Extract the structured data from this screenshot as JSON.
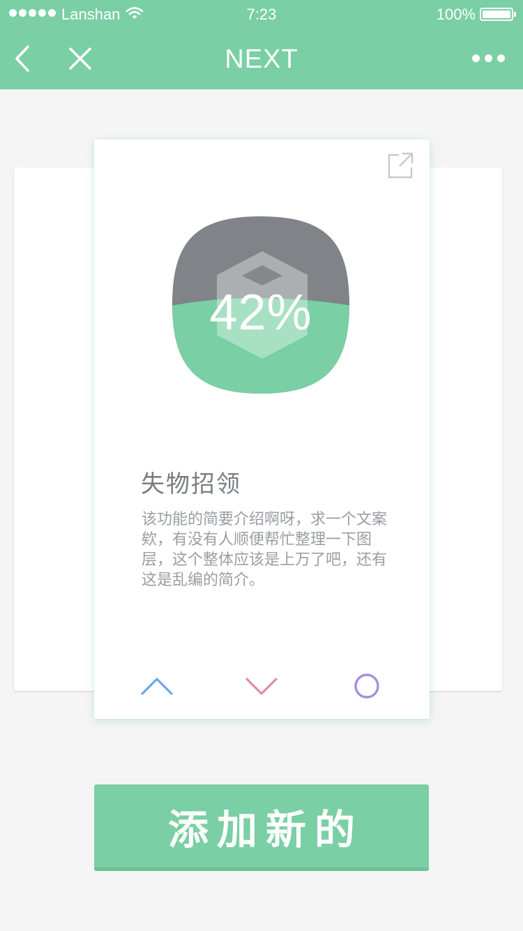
{
  "status_bar": {
    "carrier": "Lanshan",
    "time": "7:23",
    "battery": "100%"
  },
  "nav": {
    "title": "NEXT",
    "icons": [
      "back-icon",
      "close-icon",
      "more-icon"
    ]
  },
  "card": {
    "progress_label": "42%",
    "progress_value": 0.42,
    "title": "失物招领",
    "description": "该功能的简要介绍啊呀，求一个文案欸，有没有人顺便帮忙整理一下图层，这个整体应该是上万了吧，还有这是乱编的简介。",
    "actions": [
      "chevron-up-icon",
      "chevron-down-icon",
      "circle-icon"
    ]
  },
  "add_button": {
    "label": "添加新的"
  },
  "colors": {
    "primary": "#7acfa5",
    "badge_top": "#808488",
    "up_action": "#6aa9e6",
    "down_action": "#e08bb0",
    "circle_action": "#a48ee2"
  }
}
